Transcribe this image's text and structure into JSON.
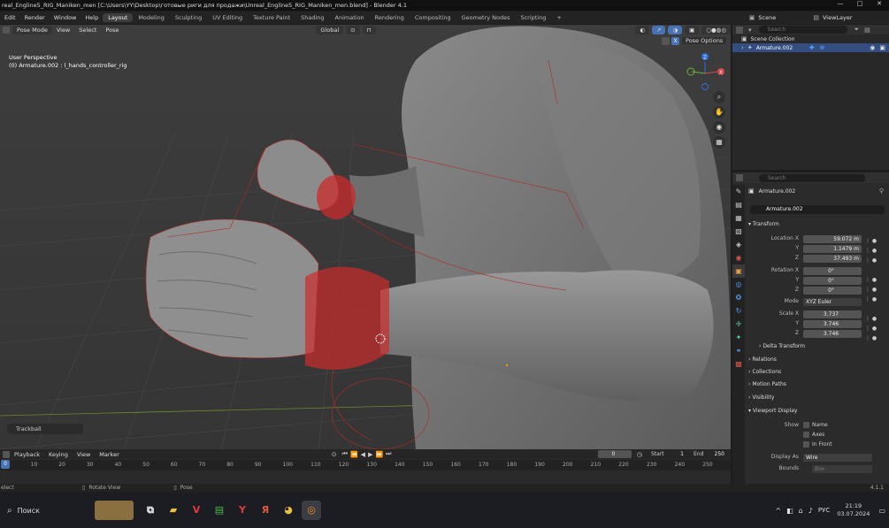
{
  "titlebar": {
    "title": "real_Engline5_RIG_Maniken_men [C:\\Users\\YY\\Desktop\\готовые риги для продажи\\Unreal_Engline5_RIG_Maniken_men.blend] - Blender 4.1",
    "min": "—",
    "max": "□",
    "close": "✕"
  },
  "menus": [
    "Edit",
    "Render",
    "Window",
    "Help"
  ],
  "workspaces": [
    "Layout",
    "Modeling",
    "Sculpting",
    "UV Editing",
    "Texture Paint",
    "Shading",
    "Animation",
    "Rendering",
    "Compositing",
    "Geometry Nodes",
    "Scripting",
    "+"
  ],
  "scene": "Scene",
  "view_layer": "ViewLayer",
  "viewport": {
    "mode": "Pose Mode",
    "menus": [
      "View",
      "Select",
      "Pose"
    ],
    "orientation": "Global",
    "pose_options": "Pose Options",
    "perspective": "User Perspective",
    "object_info": "(0) Armature.002 : l_hands_controller_rig",
    "operator": "Trackball",
    "axes": [
      "Z",
      "X",
      "Y"
    ]
  },
  "outliner": {
    "search": "Search",
    "collection": "Scene Collection",
    "item": "Armature.002"
  },
  "properties": {
    "search": "Search",
    "object_name": "Armature.002",
    "data_name": "Armature.002",
    "transform": "Transform",
    "location_label": "Location X",
    "location": [
      "59.072 m",
      "1.1479 m",
      "37.493 m"
    ],
    "rotation_label": "Rotation X",
    "rotation": [
      "0°",
      "0°",
      "0°"
    ],
    "mode_label": "Mode",
    "mode": "XYZ Euler",
    "scale_label": "Scale X",
    "scale": [
      "3.737",
      "3.746",
      "3.746"
    ],
    "axis_y": "Y",
    "axis_z": "Z",
    "sections": [
      "Delta Transform",
      "Relations",
      "Collections",
      "Motion Paths",
      "Visibility",
      "Viewport Display"
    ],
    "show_label": "Show",
    "show_items": [
      "Name",
      "Axes",
      "In Front"
    ],
    "display_as_label": "Display As",
    "display_as": "Wire",
    "bounds_label": "Bounds",
    "bounds": "Box"
  },
  "timeline": {
    "menus": [
      "Playback",
      "Keying",
      "View",
      "Marker"
    ],
    "current": "0",
    "start_label": "Start",
    "start": "1",
    "end_label": "End",
    "end": "250",
    "ticks": [
      "0",
      "10",
      "20",
      "30",
      "40",
      "50",
      "60",
      "70",
      "80",
      "90",
      "100",
      "110",
      "120",
      "130",
      "140",
      "150",
      "160",
      "170",
      "180",
      "190",
      "200",
      "210",
      "220",
      "230",
      "240",
      "250"
    ]
  },
  "statusbar": {
    "select": "elect",
    "rotate": "Rotate View",
    "pose": "Pose",
    "version": "4.1.1"
  },
  "taskbar": {
    "search": "Поиск",
    "lang": "РУС",
    "time": "21:19",
    "date": "03.07.2024"
  },
  "colors": {
    "accent": "#4772b3",
    "selected_row": "#334d80",
    "bone_red": "#cc2b2b",
    "viewport": "#3b3b3b"
  }
}
